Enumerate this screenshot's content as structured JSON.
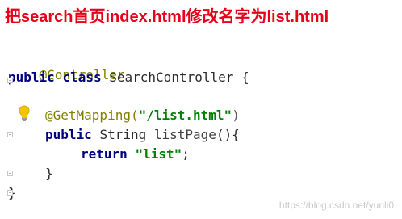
{
  "caption": "把search首页index.html修改名字为list.html",
  "code": {
    "line1": {
      "anno": "@Controller"
    },
    "line2": {
      "kw1": "public",
      "kw2": "class",
      "name": "SearchController",
      "brace": "{"
    },
    "line4": {
      "anno": "@GetMapping(",
      "str": "\"/list.html\"",
      "close": ")"
    },
    "line5": {
      "kw1": "public",
      "type": "String",
      "method": "listPage",
      "rest": "(){"
    },
    "line6": {
      "kw": "return",
      "str": "\"list\"",
      "semi": ";"
    },
    "line7": {
      "brace": "}"
    },
    "line8": {
      "brace": "}"
    }
  },
  "watermark": "https://blog.csdn.net/yunli0",
  "icons": {
    "intention": "lightbulb-icon"
  },
  "colors": {
    "caption": "#e8001a",
    "keyword": "#000080",
    "annotation": "#808000",
    "string": "#008000"
  }
}
